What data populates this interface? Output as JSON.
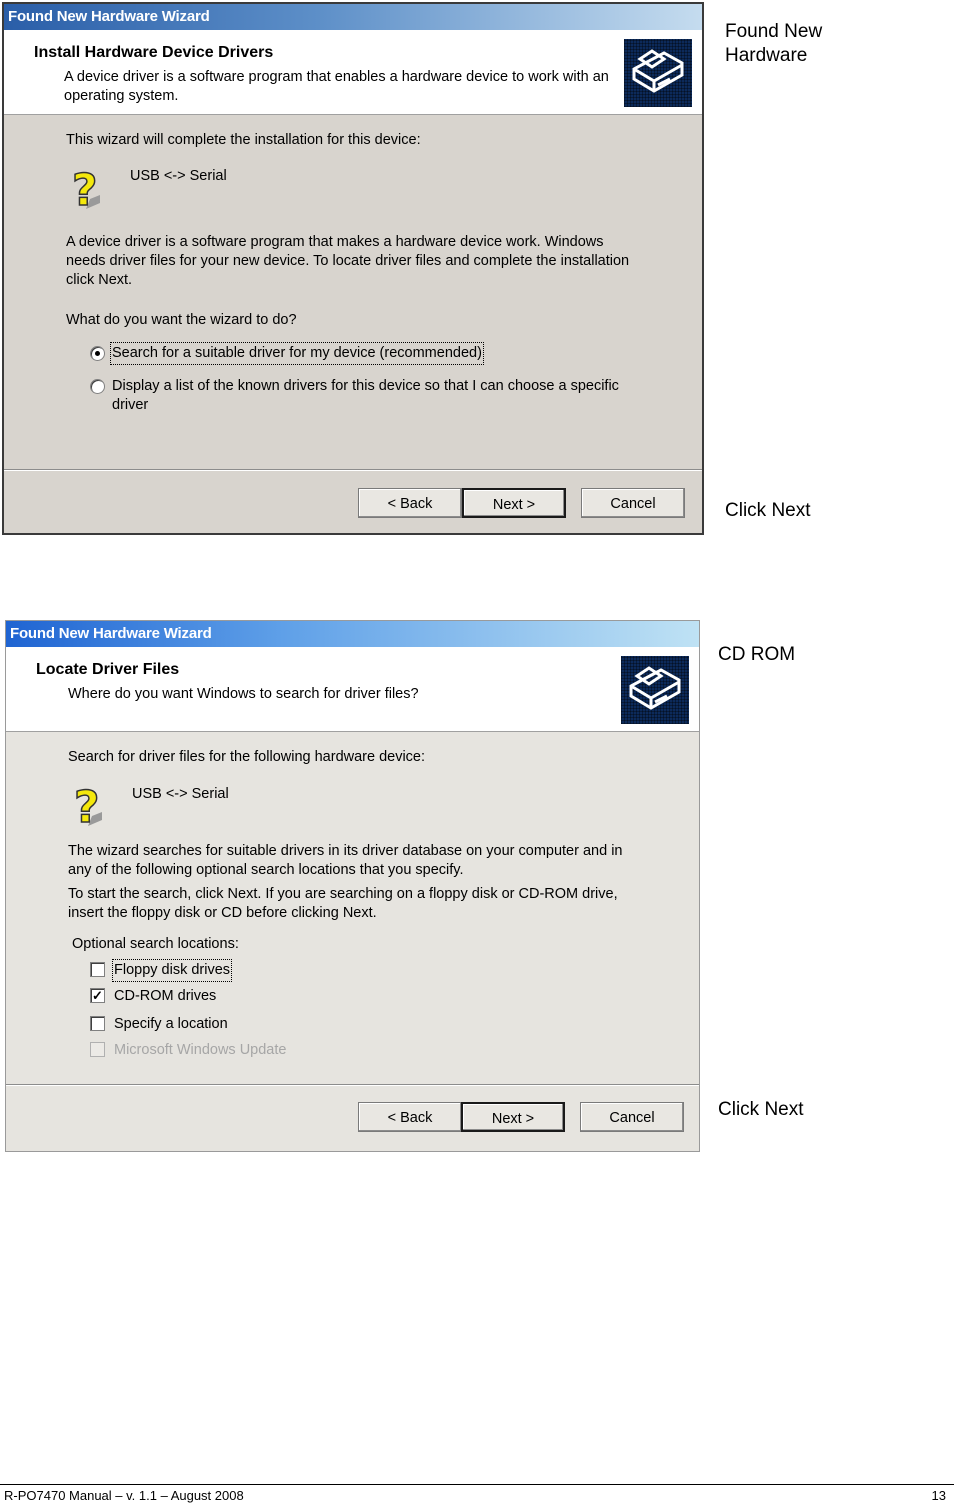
{
  "dialog1": {
    "title": "Found New Hardware Wizard",
    "heading": "Install Hardware Device Drivers",
    "subheading": "A device driver is a software program that enables a hardware device to work with an operating system.",
    "intro": "This wizard will complete the installation for this device:",
    "device_name": "USB <-> Serial",
    "description": "A device driver is a software program that makes a hardware device work. Windows needs driver files for your new device. To locate driver files and complete the installation click Next.",
    "question": "What do you want the wizard to do?",
    "options": [
      {
        "label": "Search for a suitable driver for my device (recommended)",
        "selected": true
      },
      {
        "label": "Display a list of the known drivers for this device so that I can choose a specific driver",
        "selected": false
      }
    ],
    "buttons": {
      "back": "< Back",
      "next": "Next >",
      "cancel": "Cancel"
    }
  },
  "dialog2": {
    "title": "Found New Hardware Wizard",
    "heading": "Locate Driver Files",
    "subheading": "Where do you want Windows to search for driver files?",
    "intro": "Search for driver files for the following hardware device:",
    "device_name": "USB <-> Serial",
    "description1": "The wizard searches for suitable drivers in its driver database on your computer and in any of the following optional search locations that you specify.",
    "description2": "To start the search, click Next. If you are searching on a floppy disk or CD-ROM drive, insert the floppy disk or CD before clicking Next.",
    "optional_label": "Optional search locations:",
    "checkboxes": [
      {
        "label": "Floppy disk drives",
        "checked": false,
        "enabled": true
      },
      {
        "label": "CD-ROM drives",
        "checked": true,
        "enabled": true
      },
      {
        "label": "Specify a location",
        "checked": false,
        "enabled": true
      },
      {
        "label": "Microsoft Windows Update",
        "checked": false,
        "enabled": false
      }
    ],
    "buttons": {
      "back": "< Back",
      "next": "Next >",
      "cancel": "Cancel"
    }
  },
  "notes": {
    "note1": "Found New Hardware",
    "note2": "Click Next",
    "note3": "CD ROM",
    "note4": "Click Next"
  },
  "footer": {
    "left": "R-PO7470 Manual – v. 1.1 – August 2008",
    "page": "13"
  }
}
